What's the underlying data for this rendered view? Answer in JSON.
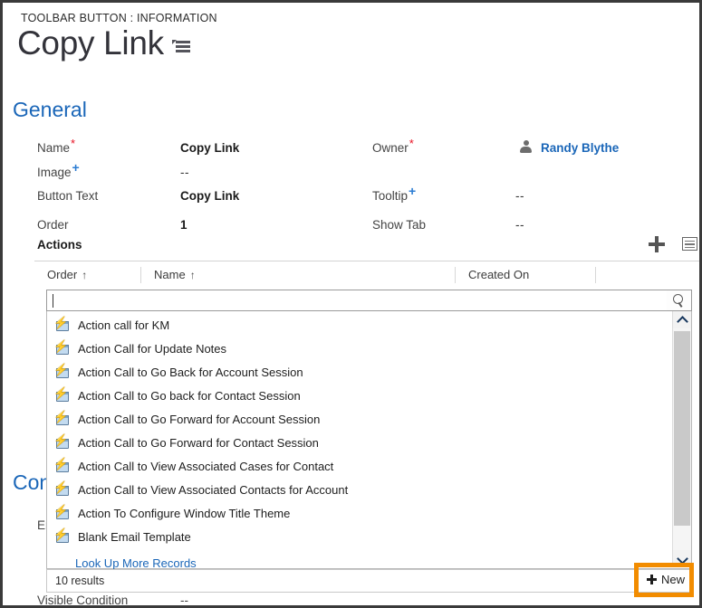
{
  "header": {
    "breadcrumb": "TOOLBAR BUTTON : INFORMATION",
    "title": "Copy Link"
  },
  "sections": {
    "general": "General",
    "conditions": "Conditions"
  },
  "form": {
    "left": [
      {
        "label": "Name",
        "marker": "required",
        "value": "Copy Link",
        "bold": true
      },
      {
        "label": "Image",
        "marker": "recommended",
        "value": "--",
        "bold": false
      },
      {
        "label": "Button Text",
        "marker": "none",
        "value": "Copy Link",
        "bold": true
      },
      {
        "label": "Order",
        "marker": "none",
        "value": "1",
        "bold": true
      }
    ],
    "right": [
      {
        "label": "Owner",
        "marker": "required",
        "value": "Randy Blythe",
        "link": true
      },
      {
        "label": "Tooltip",
        "marker": "recommended",
        "value": "--",
        "link": false
      },
      {
        "label": "Show Tab",
        "marker": "none",
        "value": "--",
        "link": false
      }
    ],
    "hidden_rows": {
      "enabled_label": "En",
      "visible_condition_label": "Visible Condition",
      "visible_condition_value": "--"
    }
  },
  "subgrid": {
    "title": "Actions",
    "add_icon": "plus-icon",
    "layout_icon": "grid-layout-icon",
    "columns": [
      {
        "label": "Order",
        "sort": "↑"
      },
      {
        "label": "Name",
        "sort": "↑"
      },
      {
        "label": "Created On",
        "sort": ""
      },
      {
        "label": "",
        "sort": ""
      }
    ]
  },
  "lookup": {
    "value": "",
    "placeholder": "",
    "search_icon": "magnifier-icon",
    "results": [
      "Action call for KM",
      "Action Call for Update Notes",
      "Action Call to Go Back for Account Session",
      "Action Call to Go back for Contact Session",
      "Action Call to Go Forward for Account Session",
      "Action Call to Go Forward for Contact Session",
      "Action Call to View Associated Cases for Contact",
      "Action Call to View Associated Contacts for Account",
      "Action To Configure Window Title Theme",
      "Blank Email Template"
    ],
    "look_up_more": "Look Up More Records",
    "results_count": "10 results",
    "new_button": "New"
  },
  "colors": {
    "section_heading": "#1a66b8",
    "link": "#1a66b8",
    "required_marker": "#e81123",
    "recommended_marker": "#2b7cd3",
    "highlight": "#F28C00",
    "frame_border": "#3a3a3a"
  }
}
